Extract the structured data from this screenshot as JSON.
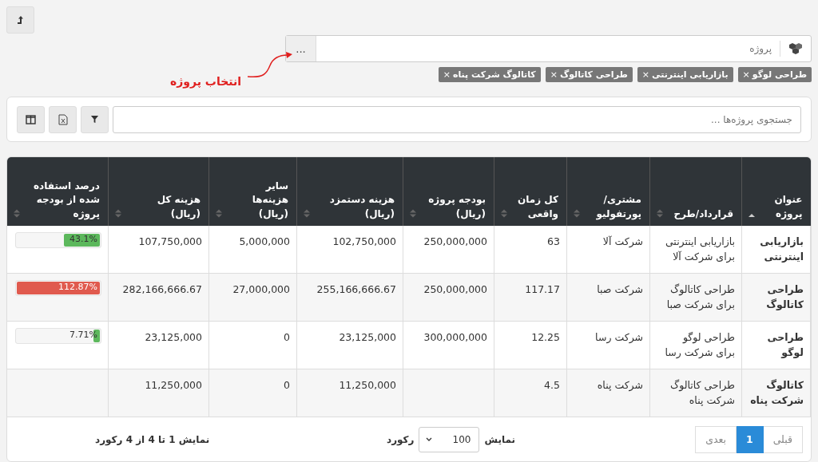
{
  "project_picker": {
    "placeholder": "پروژه",
    "browse_button": "...",
    "tags": [
      {
        "label": "طراحی لوگو",
        "remove": "×"
      },
      {
        "label": "بازاریابی اینترنتی",
        "remove": "×"
      },
      {
        "label": "طراحی کاتالوگ",
        "remove": "×"
      },
      {
        "label": "کاتالوگ شرکت پناه",
        "remove": "×"
      }
    ]
  },
  "annotation": {
    "text": "انتخاب پروژه"
  },
  "search": {
    "placeholder": "جستجوی پروژه‌ها ..."
  },
  "table": {
    "columns": [
      {
        "label": "عنوان\nپروژه",
        "sorted": true
      },
      {
        "label": "قرارداد/طرح",
        "sorted": false
      },
      {
        "label": "مشتری/\nپورتفولیو",
        "sorted": false
      },
      {
        "label": "کل زمان\nواقعی",
        "sorted": false
      },
      {
        "label": "بودجه پروژه\n(ریال)",
        "sorted": false
      },
      {
        "label": "هزینه دستمزد\n(ریال)",
        "sorted": false
      },
      {
        "label": "سایر\nهزینه‌ها\n(ریال)",
        "sorted": false
      },
      {
        "label": "هزینه کل\n(ریال)",
        "sorted": false
      },
      {
        "label": "درصد استفاده\nشده از بودجه\nپروژه",
        "sorted": false
      }
    ],
    "rows": [
      {
        "cells": [
          "بازاریابی\nاینترنتی",
          "بازاریابی اینترنتی\nبرای شرکت آلا",
          "شرکت آلا",
          "63",
          "250,000,000",
          "102,750,000",
          "5,000,000",
          "107,750,000"
        ],
        "usage": {
          "reading": "43.1%",
          "level": 0.431,
          "over_budget": false
        }
      },
      {
        "cells": [
          "طراحی\nکاتالوگ",
          "طراحی کاتالوگ\nبرای شرکت صبا",
          "شرکت صبا",
          "117.17",
          "250,000,000",
          "255,166,666.67",
          "27,000,000",
          "282,166,666.67"
        ],
        "usage": {
          "reading": "112.87%",
          "level": 1,
          "over_budget": true
        }
      },
      {
        "cells": [
          "طراحی\nلوگو",
          "طراحی لوگو\nبرای شرکت رسا",
          "شرکت رسا",
          "12.25",
          "300,000,000",
          "23,125,000",
          "0",
          "23,125,000"
        ],
        "usage": {
          "reading": "7.71%",
          "level": 0.0771,
          "over_budget": false
        }
      },
      {
        "cells": [
          "کاتالوگ\nشرکت پناه",
          "طراحی کاتالوگ\nشرکت پناه",
          "شرکت پناه",
          "4.5",
          null,
          "11,250,000",
          "0",
          "11,250,000"
        ]
      }
    ]
  },
  "footer": {
    "prev": {
      "label": "قبلی",
      "disabled": true
    },
    "pages": [
      {
        "label": "1",
        "selected": true
      }
    ],
    "next": {
      "label": "بعدی",
      "disabled": true
    },
    "page_size_label": "نمایش",
    "page_size": "100",
    "page_size_unit": "رکورد",
    "info": "نمایش 1 تا 4 از 4 رکورد"
  }
}
